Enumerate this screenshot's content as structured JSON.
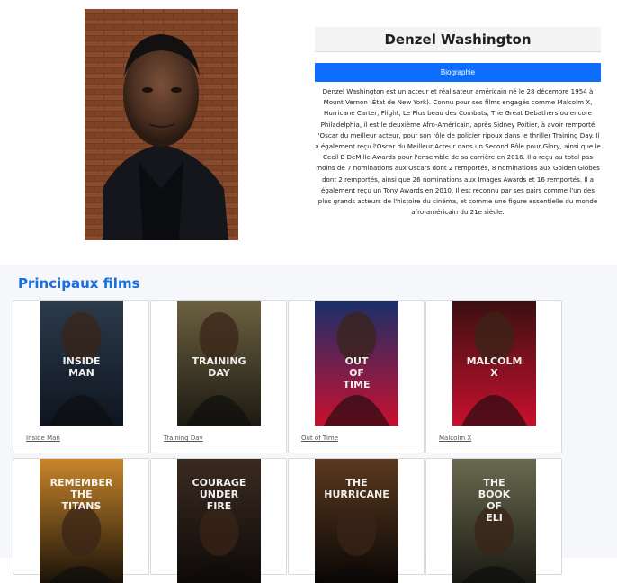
{
  "actor": {
    "name": "Denzel Washington",
    "bio_button": "Biographie",
    "bio": "Denzel Washington est un acteur et réalisateur américain né le 28 décembre 1954 à Mount Vernon (État de New York). Connu pour ses films engagés comme Malcolm X, Hurricane Carter, Flight, Le Plus beau des Combats, The Great Debathers ou encore Philadelphia, il est le deuxième Afro-Américain, après Sidney Poitier, à avoir remporté l'Oscar du meilleur acteur, pour son rôle de policier ripoux dans le thriller Training Day. Il a également reçu l'Oscar du Meilleur Acteur dans un Second Rôle pour Glory, ainsi que le Cecil B DeMille Awards pour l'ensemble de sa carrière en 2016. Il a reçu au total pas moins de 7 nominations aux Oscars dont 2 remportés, 8 nominations aux Golden Globes dont 2 remportés, ainsi que 26 nominations aux Images Awards et 16 remportés. Il a également reçu un Tony Awards en 2010. Il est reconnu par ses pairs comme l'un des plus grands acteurs de l'histoire du cinéma, et comme une figure essentielle du monde afro-américain du 21e siècle."
  },
  "films_section": {
    "title": "Principaux films",
    "films": [
      {
        "title": "Inside Man",
        "poster_text": "INSIDE MAN",
        "colors": [
          "#2c3a4a",
          "#0e1520"
        ]
      },
      {
        "title": "Training Day",
        "poster_text": "TRAINING DAY",
        "colors": [
          "#6b6040",
          "#1d1a12"
        ]
      },
      {
        "title": "Out of Time",
        "poster_text": "OUT OF TIME",
        "colors": [
          "#1a2f6a",
          "#c8102e"
        ]
      },
      {
        "title": "Malcolm X",
        "poster_text": "MALCOLM X",
        "colors": [
          "#3a1010",
          "#c8102e"
        ]
      },
      {
        "title": "",
        "poster_text": "REMEMBER THE TITANS",
        "colors": [
          "#c8862a",
          "#1a1208"
        ]
      },
      {
        "title": "",
        "poster_text": "COURAGE UNDER FIRE",
        "colors": [
          "#3a2a20",
          "#0e0a08"
        ]
      },
      {
        "title": "",
        "poster_text": "THE HURRICANE",
        "colors": [
          "#5a3a20",
          "#0a0604"
        ]
      },
      {
        "title": "",
        "poster_text": "THE BOOK OF ELI",
        "colors": [
          "#6a6a50",
          "#1a1a14"
        ]
      }
    ]
  },
  "colors": {
    "accent": "#0d6efd",
    "section_title": "#1a6fe0",
    "section_bg": "#f5f7fa"
  }
}
